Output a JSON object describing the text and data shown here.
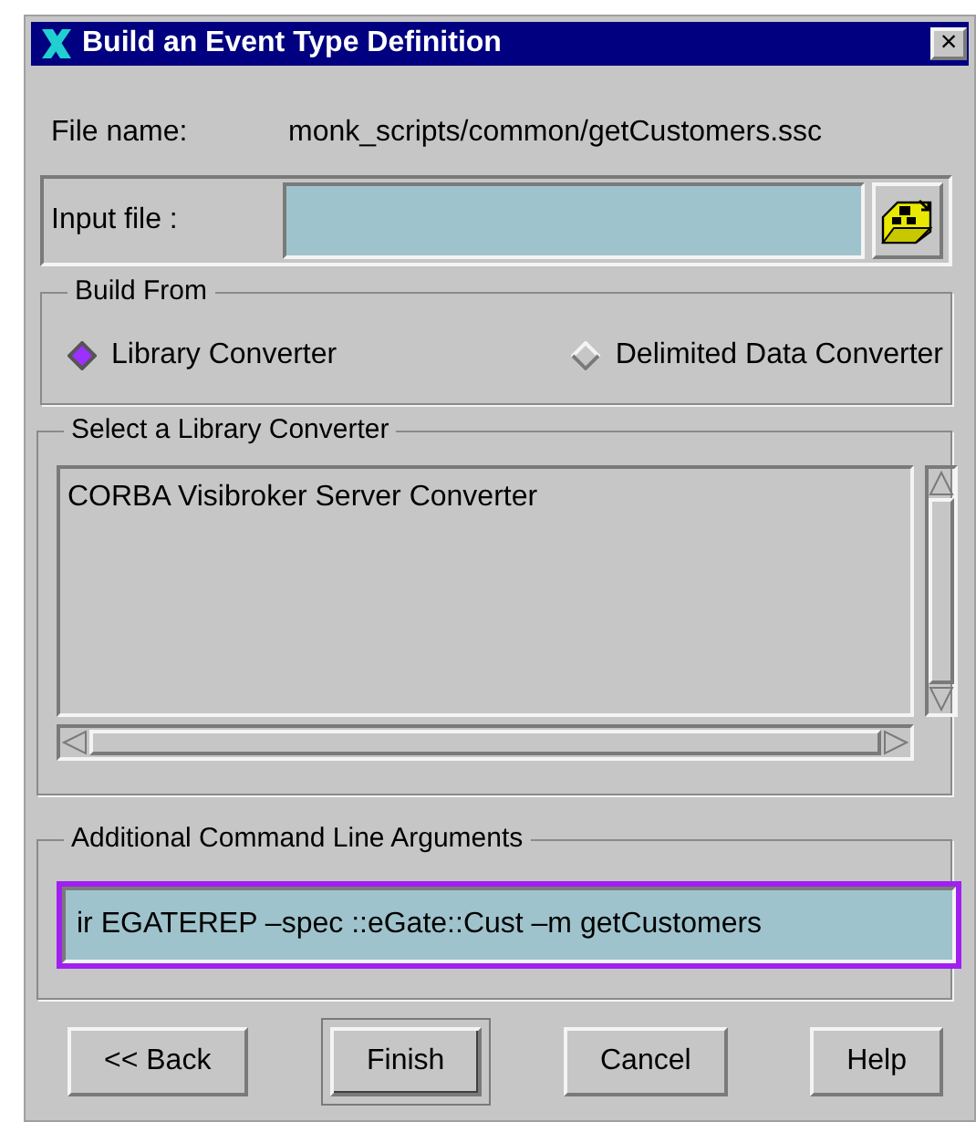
{
  "window": {
    "title": "Build an Event Type Definition",
    "close": "×"
  },
  "file_name": {
    "label": "File name:",
    "value": "monk_scripts/common/getCustomers.ssc"
  },
  "input_file": {
    "label": "Input file :"
  },
  "build_from": {
    "title": "Build From",
    "options": [
      {
        "label": "Library Converter",
        "selected": true
      },
      {
        "label": "Delimited Data Converter",
        "selected": false
      }
    ]
  },
  "converter_list": {
    "title": "Select a Library Converter",
    "items": [
      {
        "label": "CORBA Visibroker Server Converter",
        "selected": false
      }
    ]
  },
  "arguments": {
    "title": "Additional Command Line Arguments",
    "value": "ir EGATEREP –spec ::eGate::Cust –m getCustomers",
    "focused": true
  },
  "buttons": [
    {
      "label": "<< Back",
      "default": false
    },
    {
      "label": "Finish",
      "default": true
    },
    {
      "label": "Cancel",
      "default": false
    },
    {
      "label": "Help",
      "default": false
    }
  ]
}
